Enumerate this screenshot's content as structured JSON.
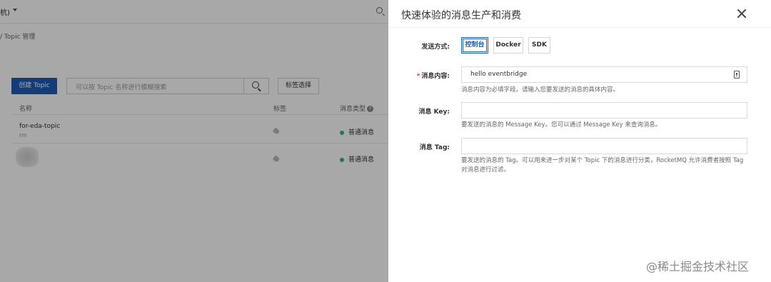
{
  "background": {
    "region_label": "杭)",
    "breadcrumb": "/ Topic 管理",
    "create_button": "创建 Topic",
    "search_placeholder": "可以按 Topic 名称进行模糊搜索",
    "tag_filter": "标签选择",
    "columns": {
      "name": "名称",
      "tags": "标签",
      "message_type": "消息类型"
    },
    "rows": [
      {
        "name": "for-eda-topic",
        "sub": "rm",
        "message_type": "普通消息"
      },
      {
        "name": "",
        "sub": "",
        "message_type": "普通消息"
      }
    ]
  },
  "drawer": {
    "title": "快速体验的消息生产和消费",
    "send_method": {
      "label": "发送方式:",
      "options": [
        "控制台",
        "Docker",
        "SDK"
      ],
      "selected": "控制台"
    },
    "content": {
      "required_mark": "*",
      "label": "消息内容:",
      "value": "hello eventbridge",
      "help": "消息内容为必填字段。请输入您要发送的消息的具体内容。"
    },
    "key": {
      "label": "消息 Key:",
      "value": "",
      "help": "要发送的消息的 Message Key。您可以通过 Message Key 来查询消息。"
    },
    "tag": {
      "label": "消息 Tag:",
      "value": "",
      "help_line1": "要发送的消息的 Tag。可以用来进一步对某个 Topic 下的消息进行分类，RocketMQ 允许消费者按照 Tag",
      "help_line2": "对消息进行过滤。"
    }
  },
  "watermark": "@稀土掘金技术社区",
  "colors": {
    "primary": "#1f5db5",
    "status_dot": "#2eb872",
    "required": "#e4393c"
  }
}
